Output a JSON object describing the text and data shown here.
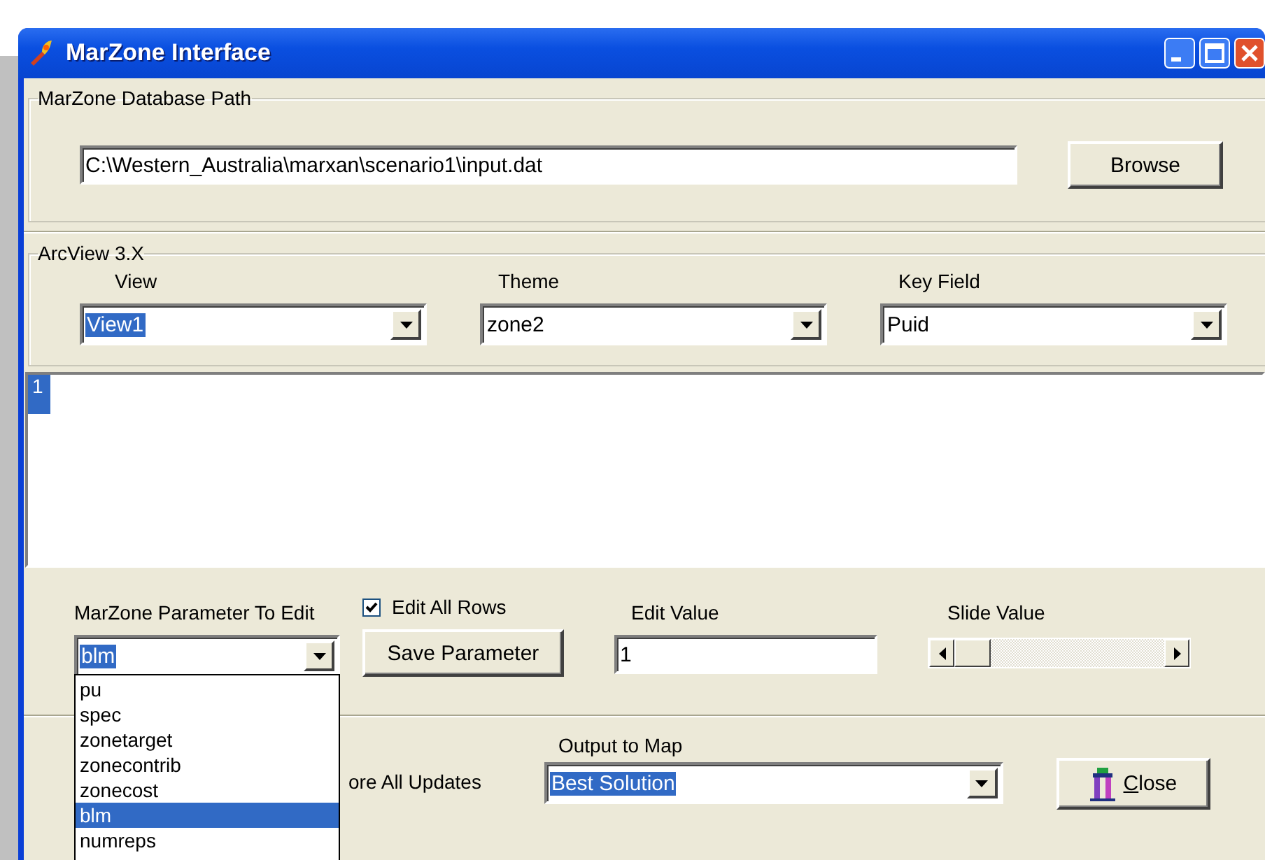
{
  "window": {
    "title": "MarZone Interface"
  },
  "database_path": {
    "group_label": "MarZone Database Path",
    "value": "C:\\Western_Australia\\marxan\\scenario1\\input.dat",
    "browse_button": "Browse"
  },
  "arcview": {
    "group_label": "ArcView 3.X",
    "fields": [
      {
        "label": "View",
        "value": "View1",
        "highlighted": true
      },
      {
        "label": "Theme",
        "value": "zone2",
        "highlighted": false
      },
      {
        "label": "Key Field",
        "value": "Puid",
        "highlighted": false
      }
    ]
  },
  "grid": {
    "rows": [
      {
        "header": "1",
        "selected": true
      }
    ]
  },
  "parameter": {
    "label": "MarZone Parameter To Edit",
    "value": "blm",
    "highlighted": true,
    "options": [
      {
        "label": "pu",
        "selected": false
      },
      {
        "label": "spec",
        "selected": false
      },
      {
        "label": "zonetarget",
        "selected": false
      },
      {
        "label": "zonecontrib",
        "selected": false
      },
      {
        "label": "zonecost",
        "selected": false
      },
      {
        "label": "blm",
        "selected": true
      },
      {
        "label": "numreps",
        "selected": false
      }
    ]
  },
  "edit_all_rows": {
    "label": "Edit All Rows",
    "checked": true
  },
  "save_button": "Save Parameter",
  "edit_value": {
    "label": "Edit Value",
    "value": "1"
  },
  "slide_value": {
    "label": "Slide Value",
    "level": 0
  },
  "updates": {
    "label": "ore All Updates"
  },
  "output": {
    "label": "Output to Map",
    "value": "Best Solution",
    "highlighted": true
  },
  "close_button": "Close"
}
